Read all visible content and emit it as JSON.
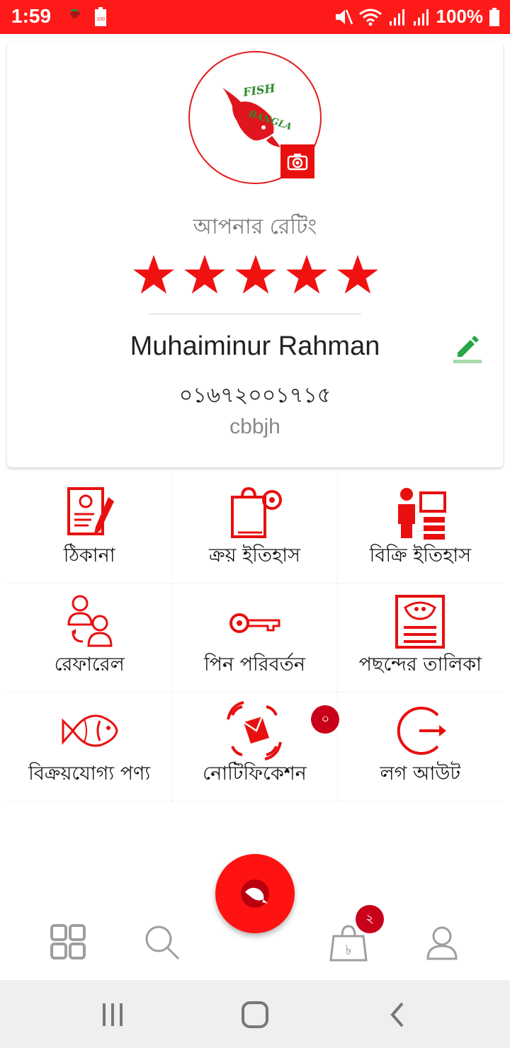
{
  "status_bar": {
    "time": "1:59",
    "battery_percent": "100%",
    "app_icon": "fish-bangla-mini-icon",
    "icons": [
      "mute-icon",
      "wifi-icon",
      "signal-icon",
      "signal-icon",
      "battery-icon"
    ]
  },
  "profile": {
    "logo_text_top": "FISH",
    "logo_text_bottom": "BANGLA",
    "rating_label": "আপনার রেটিং",
    "rating": 5,
    "rating_max": 5,
    "name": "Muhaiminur Rahman",
    "phone": "০১৬৭২০০১৭১৫",
    "extra": "cbbjh"
  },
  "menu": {
    "items": [
      {
        "label": "ঠিকানা",
        "icon": "address-icon"
      },
      {
        "label": "ক্রয় ইতিহাস",
        "icon": "purchase-history-icon"
      },
      {
        "label": "বিক্রি ইতিহাস",
        "icon": "sales-history-icon"
      },
      {
        "label": "রেফারেল",
        "icon": "referral-icon"
      },
      {
        "label": "পিন পরিবর্তন",
        "icon": "key-icon"
      },
      {
        "label": "পছন্দের তালিকা",
        "icon": "favorites-icon"
      },
      {
        "label": "বিক্রয়যোগ্য পণ্য",
        "icon": "fish-icon"
      },
      {
        "label": "নোটিফিকেশন",
        "icon": "notification-icon"
      },
      {
        "label": "লগ আউট",
        "icon": "logout-icon"
      }
    ],
    "notification_count": "০"
  },
  "bottom_nav": {
    "items": [
      "grid-icon",
      "search-icon",
      "fish-fab-icon",
      "cart-icon",
      "profile-icon"
    ],
    "cart_count": "২"
  },
  "colors": {
    "primary": "#ff1a1a",
    "icon_red": "#e80f0f",
    "badge": "#c8001a",
    "edit_green": "#27a745",
    "nav_gray": "#9e9e9e"
  }
}
